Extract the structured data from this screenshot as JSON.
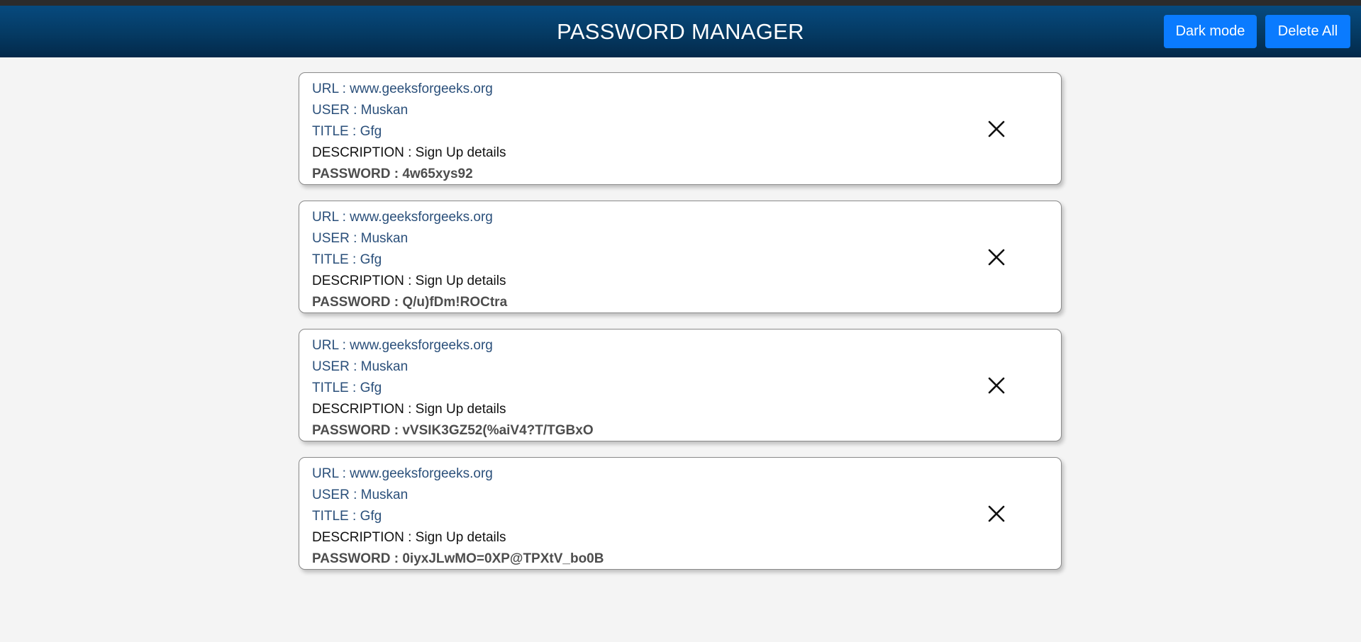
{
  "header": {
    "title": "PASSWORD MANAGER",
    "dark_mode_label": "Dark mode",
    "delete_all_label": "Delete All"
  },
  "entries": [
    {
      "url": "URL : www.geeksforgeeks.org",
      "user": "USER : Muskan",
      "title": "TITLE : Gfg",
      "description": "DESCRIPTION : Sign Up details",
      "password": "PASSWORD : 4w65xys92",
      "close_icon": "close-icon"
    },
    {
      "url": "URL : www.geeksforgeeks.org",
      "user": "USER : Muskan",
      "title": "TITLE : Gfg",
      "description": "DESCRIPTION : Sign Up details",
      "password": "PASSWORD : Q/u)fDm!ROCtra",
      "close_icon": "close-icon"
    },
    {
      "url": "URL : www.geeksforgeeks.org",
      "user": "USER : Muskan",
      "title": "TITLE : Gfg",
      "description": "DESCRIPTION : Sign Up details",
      "password": "PASSWORD : vVSIK3GZ52(%aiV4?T/TGBxO",
      "close_icon": "close-icon"
    },
    {
      "url": "URL : www.geeksforgeeks.org",
      "user": "USER : Muskan",
      "title": "TITLE : Gfg",
      "description": "DESCRIPTION : Sign Up details",
      "password": "PASSWORD : 0iyxJLwMO=0XP@TPXtV_bo0B",
      "close_icon": "close-icon"
    }
  ],
  "colors": {
    "header_bg": "#053a63",
    "button_bg": "#0a7bff",
    "link_text": "#2a4f7a",
    "page_bg": "#f4f4f4"
  }
}
